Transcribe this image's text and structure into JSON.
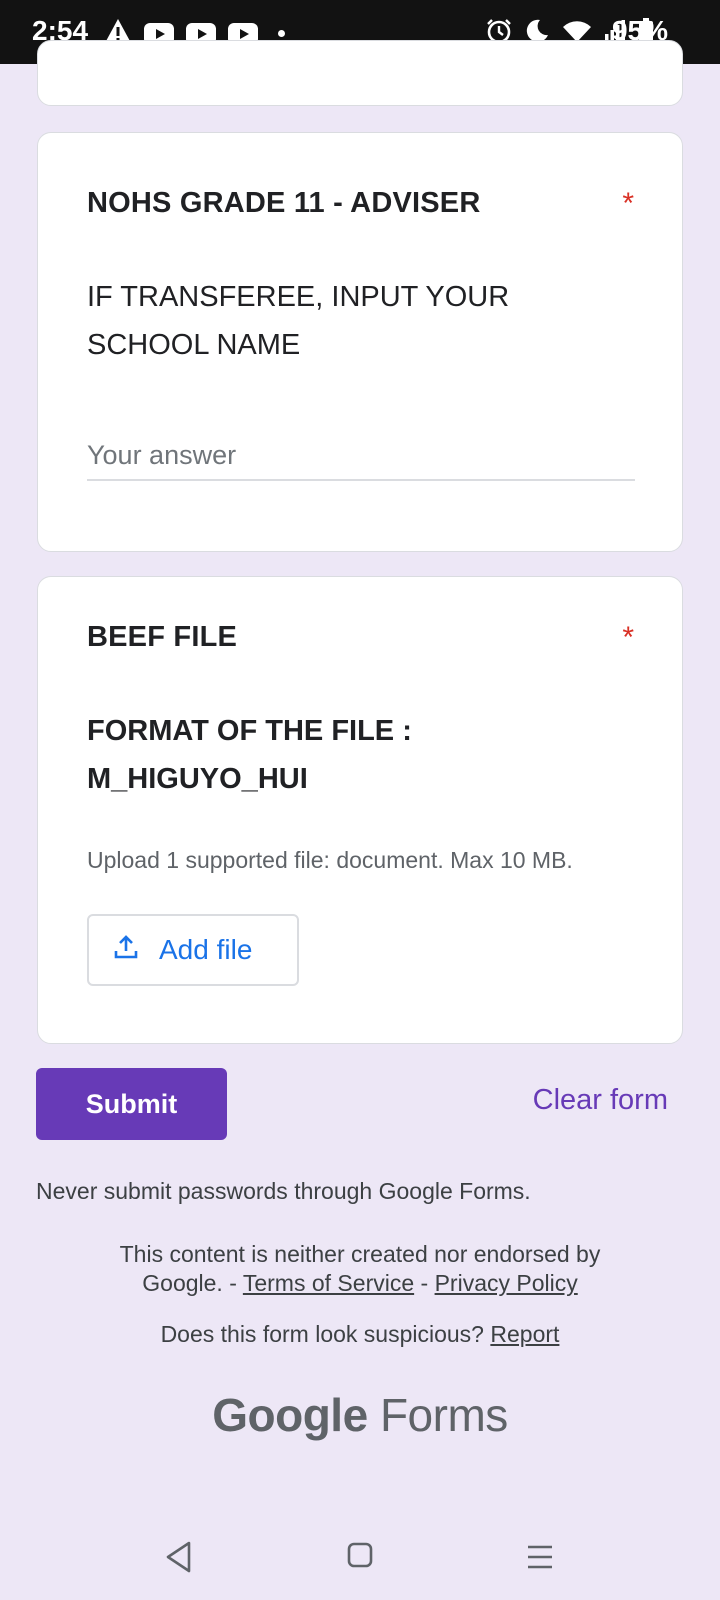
{
  "status_bar": {
    "time": "2:54",
    "battery": "95%"
  },
  "questions": [
    {
      "title": "NOHS GRADE 11 - ADVISER",
      "required_mark": "*",
      "description": "IF TRANSFEREE, INPUT YOUR SCHOOL NAME",
      "answer_placeholder": "Your answer",
      "answer_value": ""
    },
    {
      "title": "BEEF FILE",
      "required_mark": "*",
      "description": "FORMAT OF THE FILE : M_HIGUYO_HUI",
      "upload_hint": "Upload 1 supported file: document. Max 10 MB.",
      "add_file_label": "Add file"
    }
  ],
  "actions": {
    "submit_label": "Submit",
    "clear_label": "Clear form"
  },
  "footer": {
    "password_warning": "Never submit passwords through Google Forms.",
    "disclaimer_line1": "This content is neither created nor endorsed by",
    "disclaimer_google": "Google. -",
    "terms_link": "Terms of Service",
    "separator": "-",
    "privacy_link": "Privacy Policy",
    "suspicious_text": "Does this form look suspicious?",
    "report_link": "Report",
    "logo_google": "Google",
    "logo_forms": "Forms"
  },
  "colors": {
    "accent": "#673ab7",
    "link_blue": "#1a73e8",
    "required_red": "#d93025",
    "page_bg": "#ede7f6"
  },
  "icons": {
    "status_left": [
      "warning-icon",
      "youtube-icon",
      "youtube-icon",
      "youtube-icon",
      "dot-icon"
    ],
    "status_right": [
      "alarm-icon",
      "moon-icon",
      "wifi-icon",
      "signal-icon",
      "battery-icon"
    ],
    "nav": [
      "back-icon",
      "home-icon",
      "menu-icon"
    ],
    "upload": "upload-icon"
  }
}
